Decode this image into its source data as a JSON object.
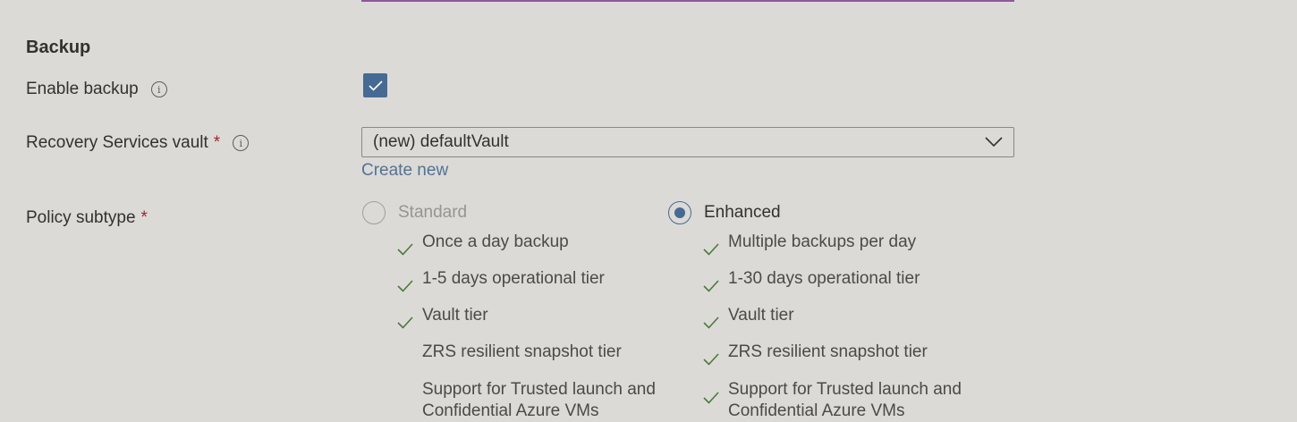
{
  "section": {
    "title": "Backup"
  },
  "enable_backup": {
    "label": "Enable backup",
    "checked": true
  },
  "vault": {
    "label": "Recovery Services vault",
    "required_mark": "*",
    "selected_value": "(new) defaultVault",
    "create_new_label": "Create new"
  },
  "policy": {
    "label": "Policy subtype",
    "required_mark": "*",
    "options": [
      {
        "label": "Standard",
        "selected": false,
        "enabled": false,
        "features": [
          {
            "text": "Once a day backup",
            "included": true
          },
          {
            "text": "1-5 days operational tier",
            "included": true
          },
          {
            "text": "Vault tier",
            "included": true
          },
          {
            "text": "ZRS resilient snapshot tier",
            "included": false
          },
          {
            "text": "Support for Trusted launch and Confidential Azure VMs",
            "included": false
          }
        ]
      },
      {
        "label": "Enhanced",
        "selected": true,
        "enabled": true,
        "features": [
          {
            "text": "Multiple backups per day",
            "included": true
          },
          {
            "text": "1-30 days operational tier",
            "included": true
          },
          {
            "text": "Vault tier",
            "included": true
          },
          {
            "text": "ZRS resilient snapshot tier",
            "included": true
          },
          {
            "text": "Support for Trusted launch and Confidential Azure VMs",
            "included": true
          }
        ]
      }
    ]
  },
  "colors": {
    "accent": "#456b94",
    "link": "#4f7399",
    "required": "#a4262c",
    "check": "#4a7a3a",
    "background": "#dcdad6"
  },
  "icons": {
    "info": "info-icon",
    "checkmark": "checkmark-icon",
    "dropdown": "chevron-down-icon"
  }
}
